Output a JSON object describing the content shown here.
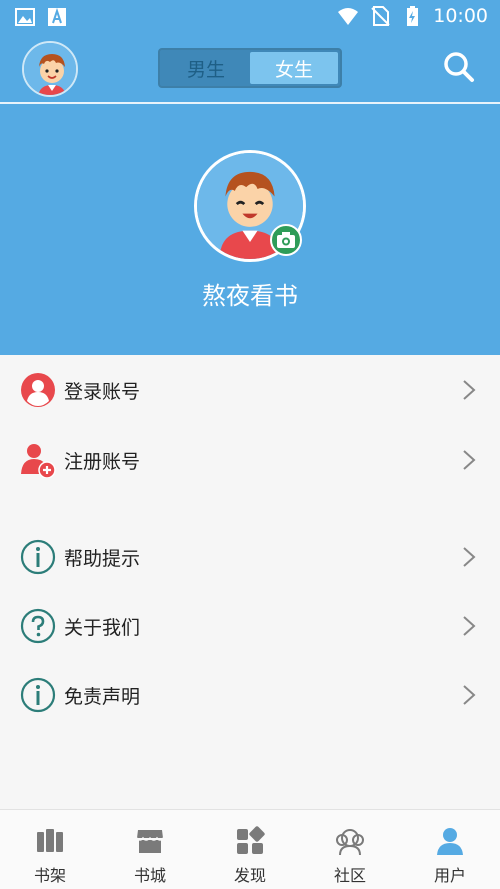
{
  "status_bar": {
    "time": "10:00",
    "left_icons": [
      "image-icon",
      "font-icon"
    ],
    "right_icons": [
      "wifi-icon",
      "no-sim-icon",
      "battery-charging-icon"
    ]
  },
  "header": {
    "avatar_icon": "cartoon-boy-avatar",
    "gender_tabs": [
      {
        "label": "男生",
        "active": false
      },
      {
        "label": "女生",
        "active": true
      }
    ],
    "search_icon": "search-icon"
  },
  "profile": {
    "username": "熬夜看书",
    "camera_icon": "camera-icon"
  },
  "menu": {
    "items": [
      {
        "label": "登录账号",
        "icon": "user-circle-icon"
      },
      {
        "label": "注册账号",
        "icon": "add-user-icon"
      },
      {
        "label": "帮助提示",
        "icon": "info-icon"
      },
      {
        "label": "关于我们",
        "icon": "question-icon"
      },
      {
        "label": "免责声明",
        "icon": "info-icon"
      }
    ]
  },
  "bottom_nav": {
    "items": [
      {
        "label": "书架",
        "icon": "bookshelf-icon",
        "active": false
      },
      {
        "label": "书城",
        "icon": "store-icon",
        "active": false
      },
      {
        "label": "发现",
        "icon": "discover-icon",
        "active": false
      },
      {
        "label": "社区",
        "icon": "community-icon",
        "active": false
      },
      {
        "label": "用户",
        "icon": "user-icon",
        "active": true
      }
    ]
  },
  "colors": {
    "primary": "#55aae3",
    "accent_green": "#2e9c58",
    "icon_red": "#e8484c",
    "icon_teal": "#2c7d79",
    "nav_active": "#55aae3",
    "nav_inactive": "#7a7a7a"
  }
}
